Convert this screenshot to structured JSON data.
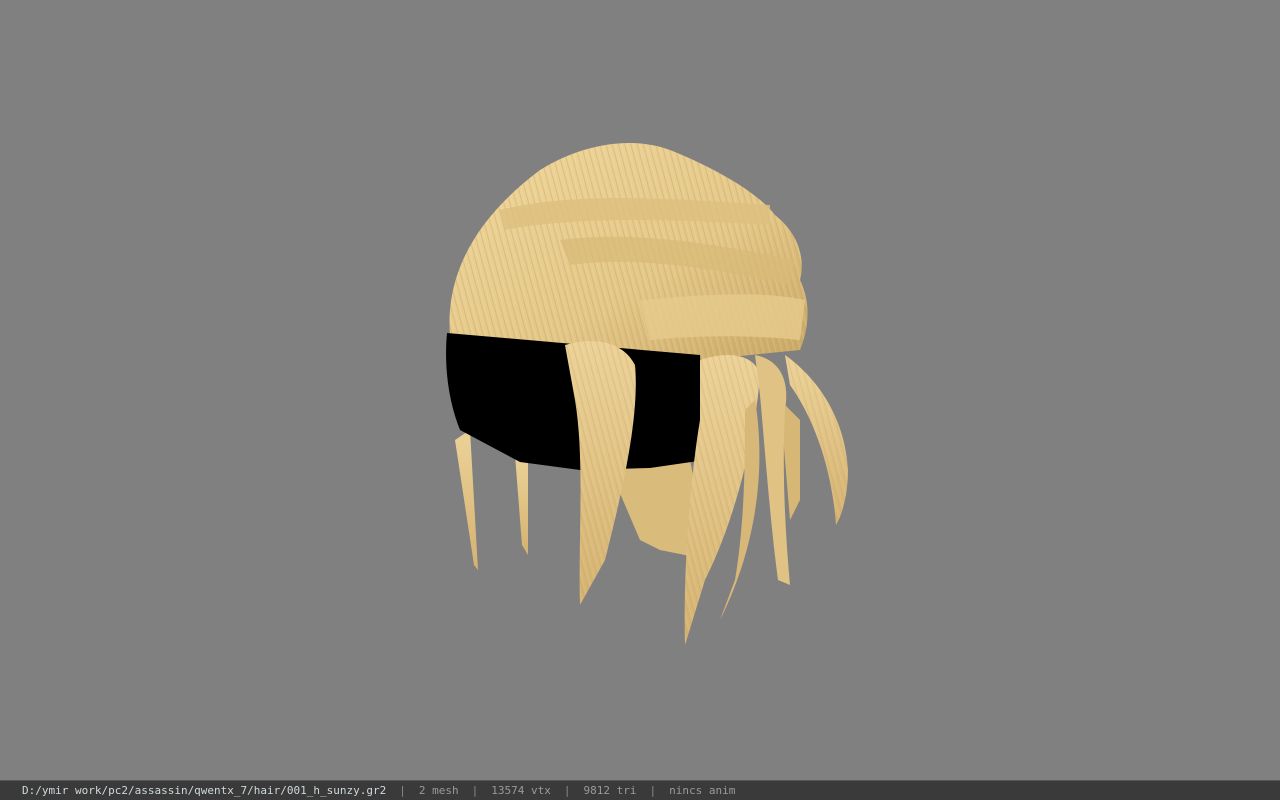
{
  "viewport": {
    "background_color": "#808080",
    "model": {
      "hair_color": "#e3c788",
      "hair_shadow_color": "#c9a765",
      "hair_strand_color": "#b8955a",
      "band_color": "#000000"
    }
  },
  "statusbar": {
    "path": "D:/ymir work/pc2/assassin/qwentx_7/hair/001_h_sunzy.gr2",
    "separator": "|",
    "mesh": "2 mesh",
    "vtx": "13574 vtx",
    "tri": "9812 tri",
    "anim": "nincs anim",
    "background_color": "#3a3a3a"
  }
}
